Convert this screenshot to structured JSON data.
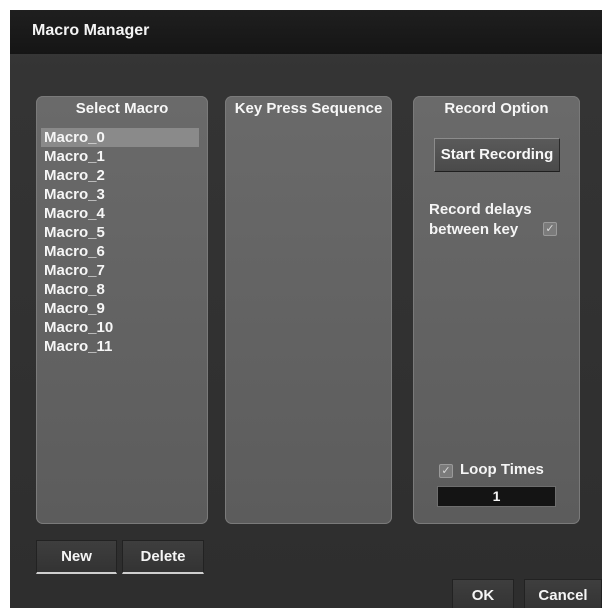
{
  "window": {
    "title": "Macro Manager"
  },
  "select_macro": {
    "header": "Select Macro",
    "items": [
      "Macro_0",
      "Macro_1",
      "Macro_2",
      "Macro_3",
      "Macro_4",
      "Macro_5",
      "Macro_6",
      "Macro_7",
      "Macro_8",
      "Macro_9",
      "Macro_10",
      "Macro_11"
    ],
    "selected_index": 0
  },
  "key_sequence": {
    "header": "Key Press Sequence"
  },
  "record_option": {
    "header": "Record Option",
    "start_label": "Start Recording",
    "delays_label": "Record delays between key",
    "delays_checked": true,
    "loop_label": "Loop Times",
    "loop_checked": true,
    "loop_value": "1"
  },
  "buttons": {
    "new": "New",
    "delete": "Delete",
    "ok": "OK",
    "cancel": "Cancel"
  },
  "colors": {
    "window_bg": "#343434",
    "panel_bg": "#636363",
    "selected_row": "#8a8a8a",
    "field_bg": "#141414"
  }
}
